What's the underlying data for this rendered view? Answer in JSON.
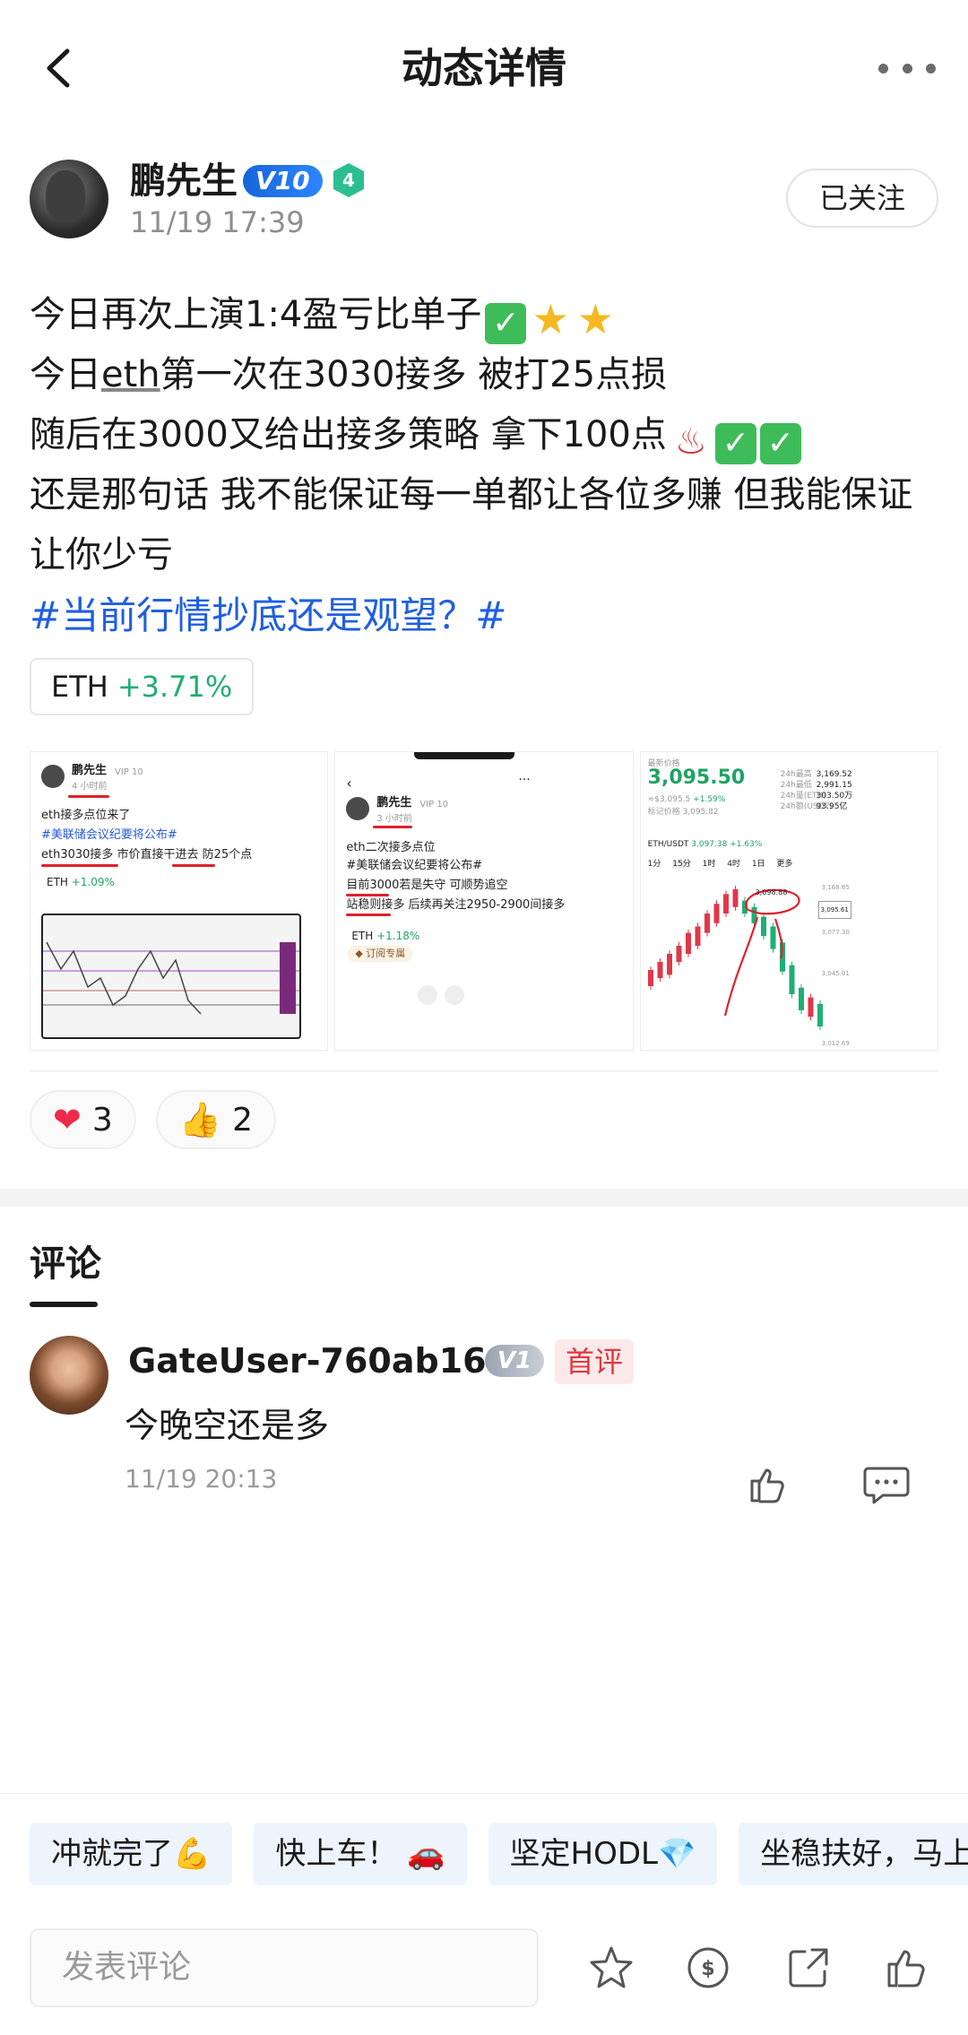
{
  "header": {
    "title": "动态详情"
  },
  "author": {
    "name": "鹏先生",
    "vip": "V10",
    "level": "4",
    "time": "11/19 17:39",
    "follow_label": "已关注"
  },
  "post": {
    "line1": "今日再次上演1:4盈亏比单子",
    "line2_a": "今日",
    "line2_word": "eth",
    "line2_b": "第一次在3030接多 被打25点损",
    "line3": "随后在3000又给出接多策略 拿下100点",
    "line4": "还是那句话 我不能保证每一单都让各位多赚 但我能保证让你少亏",
    "hashtag": "#当前行情抄底还是观望？#"
  },
  "ticker": {
    "symbol": "ETH",
    "change": "+3.71%"
  },
  "images": [
    {
      "name": "鹏先生",
      "vip": "VIP 10",
      "time": "4 小时前",
      "l1": "eth接多点位来了",
      "l2": "#美联储会议纪要将公布#",
      "l3": "eth3030接多 市价直接干进去 防25个点",
      "ticker": "ETH",
      "change": "+1.09%"
    },
    {
      "name": "鹏先生",
      "vip": "VIP 10",
      "time": "3 小时前",
      "l1": "eth二次接多点位",
      "l2": "#美联储会议纪要将公布#",
      "l3": "目前3000若是失守 可顺势追空",
      "l4": "站稳则接多 后续再关注2950-2900间接多",
      "ticker": "ETH",
      "change": "+1.18%",
      "sub": "订阅专属"
    },
    {
      "label": "最新价格",
      "price": "3,095.50",
      "sub": "≈$3,095.5",
      "sub_change": "+1.59%",
      "mark_price": "标记价格 3,095.82",
      "high_label": "24h最高",
      "high": "3,169.52",
      "low_label": "24h最低",
      "low": "2,991.15",
      "vol_label": "24h量(ETH)",
      "vol": "303.50万",
      "amt_label": "24h额(USDT)",
      "amt": "93.95亿",
      "pair": "ETH/USDT",
      "pair_price": "3,097.38",
      "pair_change": "+1.63%",
      "tabs": [
        "1分",
        "15分",
        "1时",
        "4时",
        "1日",
        "更多"
      ],
      "peak": "3,098.88",
      "axis": [
        "3,168.65",
        "3,095.61",
        "3,077.30",
        "3,045.01",
        "3,012.69"
      ]
    }
  ],
  "reactions": [
    {
      "icon": "❤",
      "count": "3"
    },
    {
      "icon": "👍",
      "count": "2"
    }
  ],
  "comments": {
    "title": "评论",
    "items": [
      {
        "name": "GateUser-760ab164",
        "vip": "V1",
        "badge": "首评",
        "text": "今晚空还是多",
        "time": "11/19 20:13"
      }
    ]
  },
  "quick_replies": [
    {
      "text": "冲就完了",
      "emoji": "💪"
    },
    {
      "text": "快上车！",
      "emoji": "🚗"
    },
    {
      "text": "坚定HODL",
      "emoji": "💎"
    },
    {
      "text": "坐稳扶好，马上",
      "emoji": ""
    }
  ],
  "input": {
    "placeholder": "发表评论"
  },
  "colors": {
    "accent": "#1f5fe0",
    "up": "#1fae73",
    "down": "#e0373f"
  }
}
